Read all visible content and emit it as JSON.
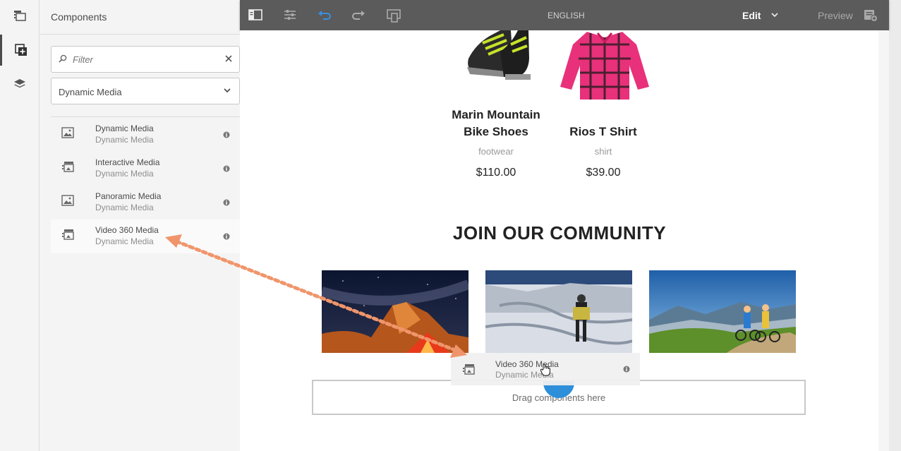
{
  "sidebar_panel": {
    "title": "Components",
    "filter_placeholder": "Filter",
    "group_selected": "Dynamic Media",
    "components": [
      {
        "name": "Dynamic Media",
        "group": "Dynamic Media",
        "icon": "image-icon"
      },
      {
        "name": "Interactive Media",
        "group": "Dynamic Media",
        "icon": "media-icon"
      },
      {
        "name": "Panoramic Media",
        "group": "Dynamic Media",
        "icon": "image-icon"
      },
      {
        "name": "Video 360 Media",
        "group": "Dynamic Media",
        "icon": "media-icon"
      }
    ]
  },
  "toolbar": {
    "language": "ENGLISH",
    "mode": "Edit",
    "preview": "Preview"
  },
  "products": [
    {
      "name": "Marin Mountain Bike Shoes",
      "category": "footwear",
      "price": "$110.00"
    },
    {
      "name": "Rios T Shirt",
      "category": "shirt",
      "price": "$39.00"
    }
  ],
  "community": {
    "title": "JOIN OUR COMMUNITY"
  },
  "dropzone": {
    "text": "Drag components here"
  },
  "drag_ghost": {
    "name": "Video 360 Media",
    "group": "Dynamic Media"
  },
  "colors": {
    "toolbar_bg": "#5b5b5b",
    "accent_blue": "#2d8fd9",
    "arrow_orange": "#f0956b"
  }
}
